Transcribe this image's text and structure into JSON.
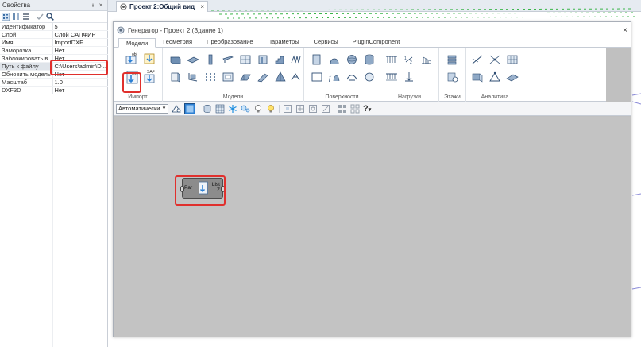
{
  "properties_panel": {
    "title": "Свойства",
    "pin_glyph": "ᵼ",
    "close_glyph": "×",
    "rows": [
      {
        "key": "Идентификатор",
        "value": "5"
      },
      {
        "key": "Слой",
        "value": "Слой САПФИР"
      },
      {
        "key": "Имя",
        "value": "ImportDXF"
      },
      {
        "key": "Заморозка",
        "value": "Нет"
      },
      {
        "key": "Заблокировать в...",
        "value": "Нет"
      },
      {
        "key": "Путь к файлу",
        "value": "C:\\Users\\admin\\D..."
      },
      {
        "key": "Обновить модель",
        "value": "Нет"
      },
      {
        "key": "Масштаб",
        "value": "1.0"
      },
      {
        "key": "DXF3D",
        "value": "Нет"
      }
    ]
  },
  "document_tab": {
    "label": "Проект 2:Общий вид",
    "close_glyph": "×"
  },
  "generator_window": {
    "title": "Генератор - Проект 2 (Здание 1)",
    "close_glyph": "×",
    "tabs": [
      "Модели",
      "Геометрия",
      "Преобразование",
      "Параметры",
      "Сервисы",
      "PluginComponent"
    ],
    "active_tab": "Модели",
    "groups": [
      {
        "label": "Импорт"
      },
      {
        "label": "Модели"
      },
      {
        "label": "Поверхности"
      },
      {
        "label": "Нагрузки"
      },
      {
        "label": "Этажи"
      },
      {
        "label": "Аналитика"
      }
    ],
    "import_icon_labels": {
      "obj": "obj",
      "saf": "SAF"
    },
    "mode_select": {
      "value": "Автоматически",
      "arrow": "▾"
    },
    "help_glyph": "?",
    "help_arrow": "▾"
  },
  "node": {
    "left_port": "Par",
    "right_port": "List",
    "right_sub": "Z"
  },
  "colors": {
    "highlight": "#e0302d",
    "canvas": "#c3c3c3",
    "accent_icon": "#2a7fd4",
    "node_body": "#8c8c8c"
  }
}
